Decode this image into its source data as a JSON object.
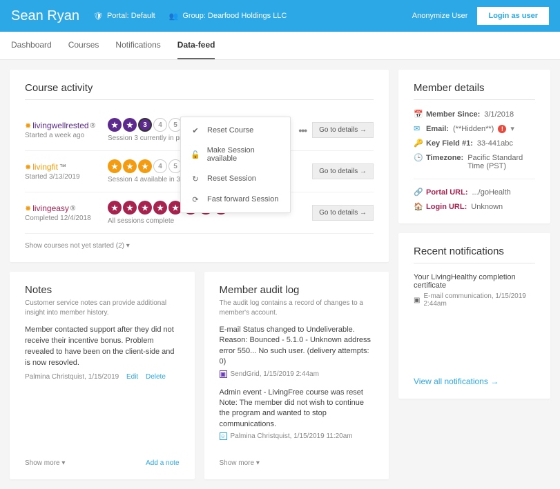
{
  "header": {
    "user_name": "Sean Ryan",
    "portal_label": "Portal: Default",
    "group_label": "Group: Dearfood Holdings LLC",
    "anonymize": "Anonymize User",
    "login_as": "Login as user"
  },
  "tabs": [
    "Dashboard",
    "Courses",
    "Notifications",
    "Data-feed"
  ],
  "active_tab": 3,
  "course_activity": {
    "title": "Course activity",
    "courses": [
      {
        "name": "livingwellrested",
        "reg": "®",
        "sub": "Started a week ago",
        "color": "#5b2a8c",
        "done_count": 3,
        "open_nums": [
          "4",
          "5",
          "6",
          "7",
          "8"
        ],
        "hint": "Session 3 currently in progress",
        "details": "Go to details →",
        "has_menu": true
      },
      {
        "name": "livingfit",
        "reg": "™",
        "sub": "Started 3/13/2019",
        "color": "#f39c12",
        "done_count": 3,
        "open_nums": [
          "4",
          "5",
          "6",
          "7",
          "8"
        ],
        "hint": "Session 4 available in 3 days (4/2/2019)",
        "details": "Go to details →",
        "has_menu": false
      },
      {
        "name": "livingeasy",
        "reg": "®",
        "sub": "Completed 12/4/2018",
        "color": "#a6234f",
        "done_count": 8,
        "open_nums": [],
        "hint": "All sessions complete",
        "details": "Go to details →",
        "has_menu": false
      }
    ],
    "menu": {
      "reset_course": "Reset Course",
      "make_available": "Make Session available",
      "reset_session": "Reset Session",
      "fast_forward": "Fast forward Session"
    },
    "show_toggle": "Show courses not yet started (2) ▾"
  },
  "notes": {
    "title": "Notes",
    "desc": "Customer service notes can provide additional insight into member history.",
    "body": "Member contacted support after they did not receive their incentive bonus. Problem revealed to have been on the client-side and is now resovled.",
    "author": "Palmina Christquist, 1/15/2019",
    "edit": "Edit",
    "delete": "Delete",
    "show_more": "Show more ▾",
    "add": "Add a note"
  },
  "audit": {
    "title": "Member audit log",
    "desc": "The audit log contains a record of changes to a member's account.",
    "items": [
      {
        "text": "E-mail Status changed to Undeliverable. Reason: Bounced - 5.1.0 - Unknown address error 550... No such user. (delivery attempts: 0)",
        "icon_color": "#6a3fb5",
        "source": "SendGrid, 1/15/2019 2:44am"
      },
      {
        "text": "Admin event - LivingFree course was reset",
        "note": "Note: The member did not wish to continue the program and wanted to stop communications.",
        "icon_color": "#2ca8e6",
        "source": "Palmina Christquist, 1/15/2019 11:20am"
      }
    ],
    "show_more": "Show more ▾"
  },
  "member_details": {
    "title": "Member details",
    "since_label": "Member Since:",
    "since_val": "3/1/2018",
    "email_label": "Email:",
    "email_val": "(**Hidden**)",
    "keyfield_label": "Key Field #1:",
    "keyfield_val": "33-441abc",
    "tz_label": "Timezone:",
    "tz_val": "Pacific Standard Time (PST)",
    "portal_label": "Portal URL:",
    "portal_val": ".../goHealth",
    "login_label": "Login URL:",
    "login_val": "Unknown"
  },
  "recent_notifs": {
    "title": "Recent notifications",
    "item_title": "Your LivingHealthy completion certificate",
    "item_meta": "E-mail communication, 1/15/2019 2:44am",
    "view_all": "View all notifications →"
  }
}
